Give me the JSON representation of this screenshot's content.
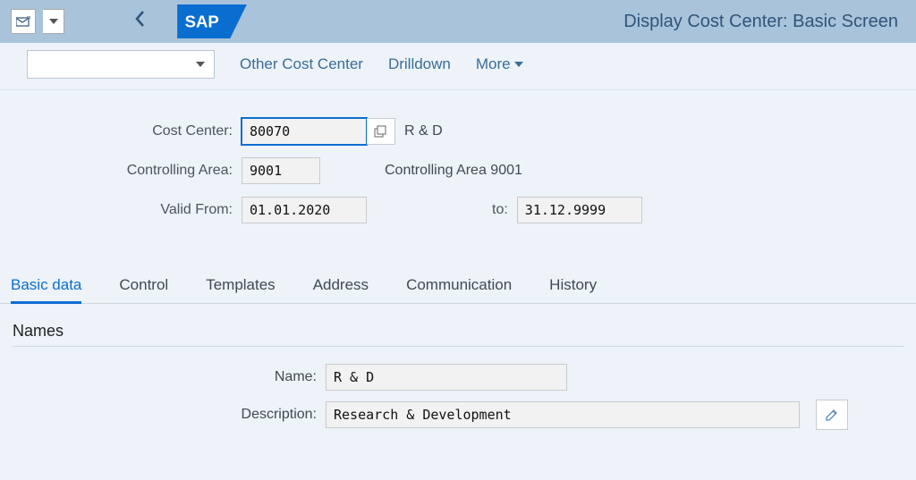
{
  "header": {
    "title": "Display Cost Center: Basic Screen"
  },
  "toolbar": {
    "links": {
      "other": "Other Cost Center",
      "drilldown": "Drilldown",
      "more": "More"
    }
  },
  "form": {
    "cost_center": {
      "label": "Cost Center:",
      "value": "80070",
      "text": "R & D"
    },
    "controlling_area": {
      "label": "Controlling Area:",
      "value": "9001",
      "text": "Controlling Area 9001"
    },
    "valid_from": {
      "label": "Valid From:",
      "value": "01.01.2020"
    },
    "valid_to": {
      "label": "to:",
      "value": "31.12.9999"
    }
  },
  "tabs": {
    "basic": "Basic data",
    "control": "Control",
    "templates": "Templates",
    "address": "Address",
    "communication": "Communication",
    "history": "History"
  },
  "section": {
    "names_title": "Names",
    "name": {
      "label": "Name:",
      "value": "R & D"
    },
    "description": {
      "label": "Description:",
      "value": "Research & Development"
    }
  }
}
